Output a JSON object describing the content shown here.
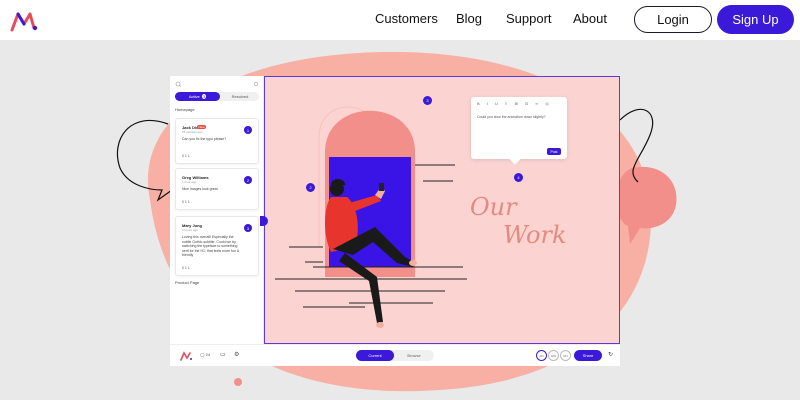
{
  "nav": {
    "links": [
      "Customers",
      "Blog",
      "Support",
      "About"
    ],
    "login_label": "Login",
    "signup_label": "Sign Up"
  },
  "sidebar": {
    "tabs": {
      "active": "Active",
      "active_count": "3",
      "resolved": "Resolved"
    },
    "section_homepage": "Homepage",
    "section_product": "Product Page",
    "comments": [
      {
        "name": "Jack Dixon",
        "badge": "New",
        "time": "15 minutes ago",
        "text": "Can you fix the typo please?",
        "number": "1",
        "meta": "0  1  1"
      },
      {
        "name": "Greg Williams",
        "time": "1 hour ago",
        "text": "Nice images look great",
        "number": "2",
        "meta": "0  1  1"
      },
      {
        "name": "Mary Jung",
        "time": "2 hours ago",
        "text": "Loving this overall! Especially the subtle Gothic subtitle. Could we try switching the typeface to something serif for the H1, that feels more fun & friendly",
        "number": "3",
        "meta": "0  1  1"
      }
    ]
  },
  "canvas": {
    "headline_line1": "Our",
    "headline_line2": "Work",
    "pins": [
      "1",
      "2",
      "3",
      "4"
    ],
    "comment_prompt": "Could you slow the animation down slightly?",
    "comment_post": "Post",
    "comment_tools": "B I U ≡ ⊞ ⊡ ∞ ◎"
  },
  "toolbar": {
    "current": "Current",
    "browse": "Browse",
    "comment_count": "24",
    "avatars": [
      "AD",
      "GW",
      "MJ"
    ],
    "share": "Share"
  },
  "colors": {
    "accent": "#3a1ad8",
    "blob": "#f8b0a4",
    "canvas": "#fbd4d2",
    "arch": "#f28f8a",
    "window": "#3a14e6",
    "shirt": "#e7342c",
    "script": "#e58a80"
  }
}
